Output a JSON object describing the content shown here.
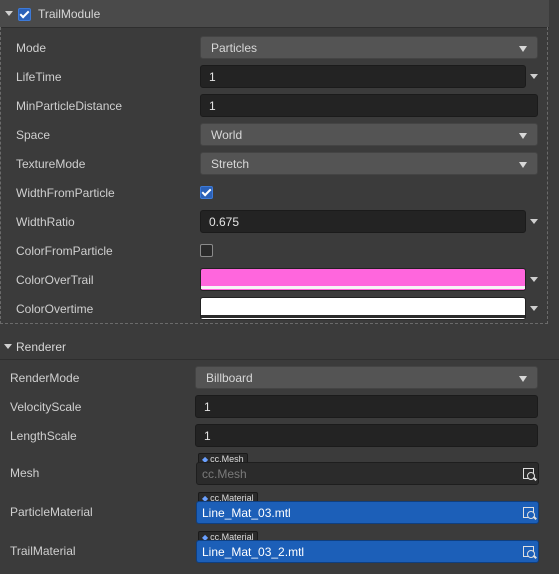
{
  "trail_module": {
    "title": "TrailModule",
    "enabled": true,
    "props": {
      "mode": {
        "label": "Mode",
        "value": "Particles"
      },
      "lifetime": {
        "label": "LifeTime",
        "value": "1"
      },
      "min_particle_distance": {
        "label": "MinParticleDistance",
        "value": "1"
      },
      "space": {
        "label": "Space",
        "value": "World"
      },
      "texture_mode": {
        "label": "TextureMode",
        "value": "Stretch"
      },
      "width_from_particle": {
        "label": "WidthFromParticle",
        "checked": true
      },
      "width_ratio": {
        "label": "WidthRatio",
        "value": "0.675"
      },
      "color_from_particle": {
        "label": "ColorFromParticle",
        "checked": false
      },
      "color_over_trail": {
        "label": "ColorOverTrail",
        "color": "#ff66dd"
      },
      "color_overtime": {
        "label": "ColorOvertime",
        "color": "#ffffff"
      }
    }
  },
  "renderer": {
    "title": "Renderer",
    "props": {
      "render_mode": {
        "label": "RenderMode",
        "value": "Billboard"
      },
      "velocity_scale": {
        "label": "VelocityScale",
        "value": "1"
      },
      "length_scale": {
        "label": "LengthScale",
        "value": "1"
      },
      "mesh": {
        "label": "Mesh",
        "type_tag": "cc.Mesh",
        "value": "cc.Mesh"
      },
      "particle_material": {
        "label": "ParticleMaterial",
        "type_tag": "cc.Material",
        "value": "Line_Mat_03.mtl"
      },
      "trail_material": {
        "label": "TrailMaterial",
        "type_tag": "cc.Material",
        "value": "Line_Mat_03_2.mtl"
      }
    }
  },
  "icons": {
    "expand": "chevron-down-icon",
    "dropdown": "caret-down-icon",
    "locate": "locate-asset-icon",
    "asset_type": "diamond-icon"
  },
  "colors": {
    "accent": "#2b61b8",
    "asset_selected": "#1c5fb8",
    "panel_bg": "#3b3b3b"
  }
}
